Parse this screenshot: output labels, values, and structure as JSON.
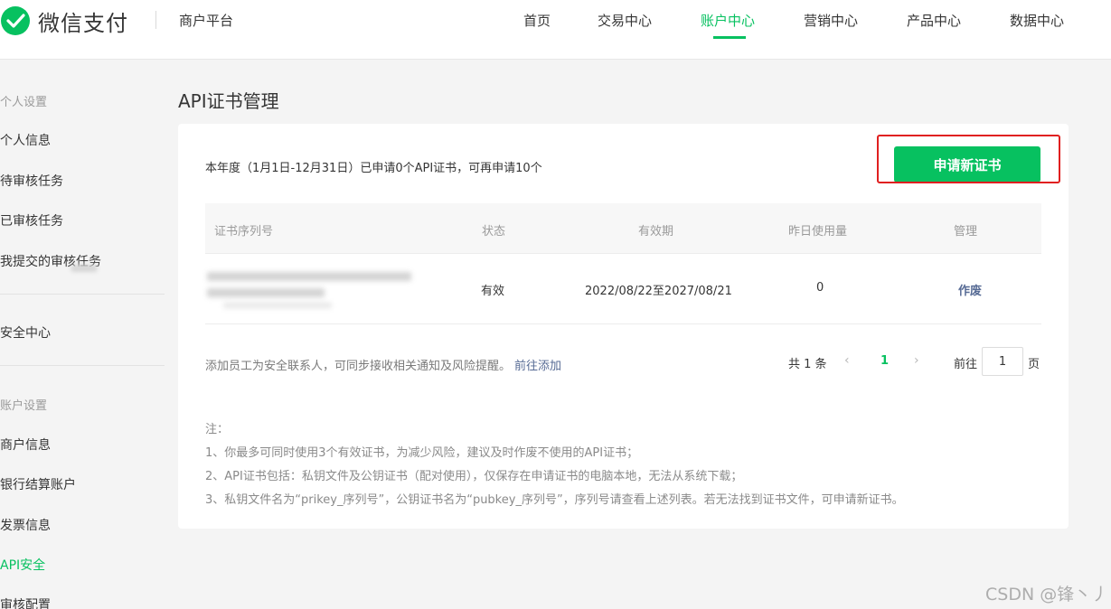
{
  "header": {
    "brand": "微信支付",
    "platform": "商户平台",
    "nav": [
      {
        "label": "首页",
        "active": false
      },
      {
        "label": "交易中心",
        "active": false
      },
      {
        "label": "账户中心",
        "active": true
      },
      {
        "label": "营销中心",
        "active": false
      },
      {
        "label": "产品中心",
        "active": false
      },
      {
        "label": "数据中心",
        "active": false
      }
    ]
  },
  "sidebar": {
    "group1": "个人设置",
    "personal_items": [
      "个人信息",
      "待审核任务",
      "已审核任务",
      "我提交的审核任务"
    ],
    "security": "安全中心",
    "group2": "账户设置",
    "account_items": [
      "商户信息",
      "银行结算账户",
      "发票信息",
      "API安全",
      "审核配置"
    ],
    "active_item": "API安全"
  },
  "main": {
    "title": "API证书管理",
    "quota_text": "本年度（1月1日-12月31日）已申请0个API证书，可再申请10个",
    "apply_button": "申请新证书",
    "table": {
      "headers": [
        "证书序列号",
        "状态",
        "有效期",
        "昨日使用量",
        "管理"
      ],
      "rows": [
        {
          "serial": "",
          "status": "有效",
          "validity": "2022/08/22至2027/08/21",
          "usage": "0",
          "action": "作废"
        }
      ]
    },
    "hint": "添加员工为安全联系人，可同步接收相关通知及风险提醒。",
    "hint_link": "前往添加",
    "pagination": {
      "total": "共 1 条",
      "prev_icon": "chevron-left-icon",
      "current": "1",
      "next_icon": "chevron-right-icon",
      "goto_label": "前往",
      "goto_value": "1",
      "goto_suffix": "页"
    },
    "notes": {
      "title": "注：",
      "lines": [
        "1、你最多可同时使用3个有效证书，为减少风险，建议及时作废不使用的API证书；",
        "2、API证书包括：私钥文件及公钥证书（配对使用），仅保存在申请证书的电脑本地，无法从系统下载；",
        "3、私钥文件名为“prikey_序列号”，公钥证书名为“pubkey_序列号”，序列号请查看上述列表。若无法找到证书文件，可申请新证书。"
      ]
    }
  },
  "watermark": "CSDN @锋丶丿",
  "colors": {
    "accent": "#07c160",
    "link": "#576b95",
    "highlight": "#e02020"
  }
}
